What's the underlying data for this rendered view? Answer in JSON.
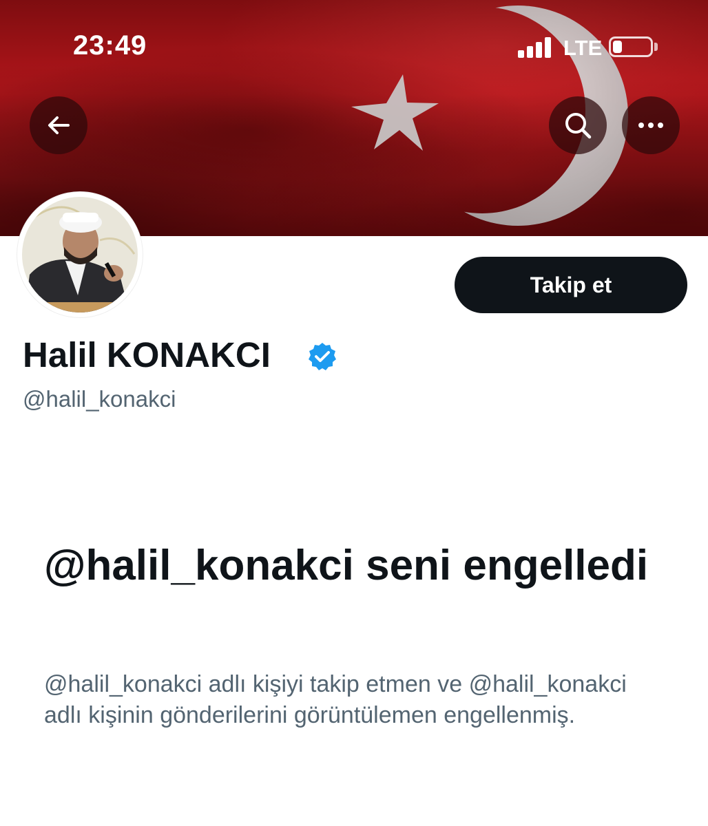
{
  "status_bar": {
    "time": "23:49",
    "network": "LTE",
    "battery_level": 0.25
  },
  "header": {
    "back_icon": "arrow-left-icon",
    "search_icon": "search-icon",
    "more_icon": "more-horizontal-icon",
    "banner_colors": {
      "red": "#b5161b",
      "crescent": "#cfcfcf"
    }
  },
  "profile": {
    "display_name": "Halil KONAKCI",
    "verified": true,
    "verified_color": "#1d9bf0",
    "handle": "@halil_konakci",
    "follow_label": "Takip et"
  },
  "blocked": {
    "title": "@halil_konakci seni engelledi",
    "description": "@halil_konakci adlı kişiyi takip etmen ve @halil_konakci adlı kişinin gönderilerini görüntülemen engellenmiş."
  }
}
